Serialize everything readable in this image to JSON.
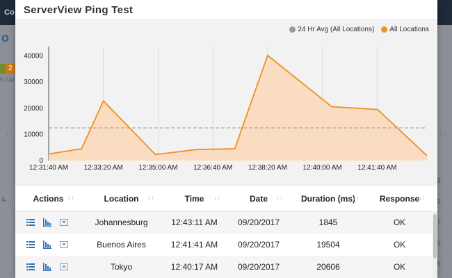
{
  "background": {
    "brand": "Co",
    "title": "o",
    "badge": "2",
    "am_text": "5 AM",
    "left_link": "4...",
    "right_numbers": [
      "9",
      "0",
      "7",
      "5",
      "8"
    ]
  },
  "modal": {
    "title": "ServerView Ping Test"
  },
  "colors": {
    "accent": "#f0901e",
    "fill": "#f9d9bd",
    "avg": "#9a9a9a",
    "icon_blue": "#2f6db5"
  },
  "chart_data": {
    "type": "area",
    "legend": [
      "24 Hr Avg (All Locations)",
      "All Locations"
    ],
    "legend_placement": "top-right",
    "x_tick_labels": [
      "12:31:40 AM",
      "12:33:20 AM",
      "12:35:00 AM",
      "12:36:40 AM",
      "12:38:20 AM",
      "12:40:00 AM",
      "12:41:40 AM"
    ],
    "y_tick_labels": [
      "0",
      "10000",
      "20000",
      "30000",
      "40000"
    ],
    "ylim": [
      0,
      42000
    ],
    "grid": true,
    "series": [
      {
        "name": "All Locations",
        "points": [
          {
            "t": "12:31:40 AM",
            "y": 2500
          },
          {
            "t": "12:32:40 AM",
            "y": 4500
          },
          {
            "t": "12:33:20 AM",
            "y": 22800
          },
          {
            "t": "12:34:55 AM",
            "y": 2300
          },
          {
            "t": "12:36:10 AM",
            "y": 4200
          },
          {
            "t": "12:37:20 AM",
            "y": 4500
          },
          {
            "t": "12:38:20 AM",
            "y": 40200
          },
          {
            "t": "12:40:17 AM",
            "y": 20606
          },
          {
            "t": "12:41:41 AM",
            "y": 19504
          },
          {
            "t": "12:43:11 AM",
            "y": 1845
          }
        ]
      },
      {
        "name": "24 Hr Avg (All Locations)",
        "constant": 12500
      }
    ]
  },
  "table": {
    "headers": [
      "Actions",
      "Location",
      "Time",
      "Date",
      "Duration (ms)",
      "Response"
    ],
    "rows": [
      {
        "location": "Johannesburg",
        "time": "12:43:11 AM",
        "date": "09/20/2017",
        "duration": "1845",
        "response": "OK"
      },
      {
        "location": "Buenos Aires",
        "time": "12:41:41 AM",
        "date": "09/20/2017",
        "duration": "19504",
        "response": "OK"
      },
      {
        "location": "Tokyo",
        "time": "12:40:17 AM",
        "date": "09/20/2017",
        "duration": "20606",
        "response": "OK"
      }
    ],
    "action_icons": [
      "list-icon",
      "bar-chart-icon",
      "detail-icon"
    ]
  }
}
